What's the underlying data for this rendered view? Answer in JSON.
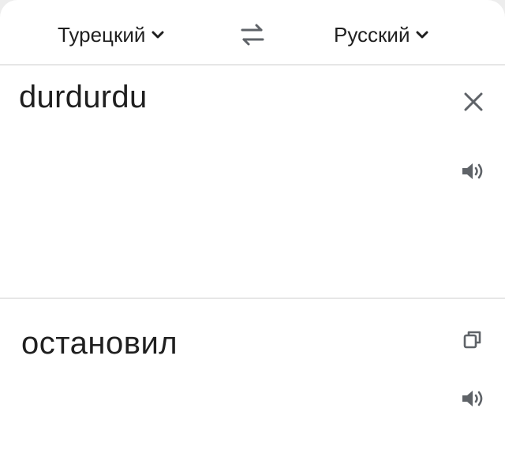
{
  "header": {
    "source_language": "Турецкий",
    "target_language": "Русский",
    "chevron_icon": "chevron-down-icon",
    "swap_icon": "swap-arrows-icon"
  },
  "source": {
    "text": "durdurdu",
    "clear_icon": "close-icon",
    "speak_icon": "speaker-icon"
  },
  "translation": {
    "text": "остановил",
    "copy_icon": "copy-icon",
    "speak_icon": "speaker-icon"
  },
  "colors": {
    "icon": "#5f6368",
    "text": "#1f1f1f",
    "divider": "#e6e6e6",
    "background": "#ffffff"
  }
}
